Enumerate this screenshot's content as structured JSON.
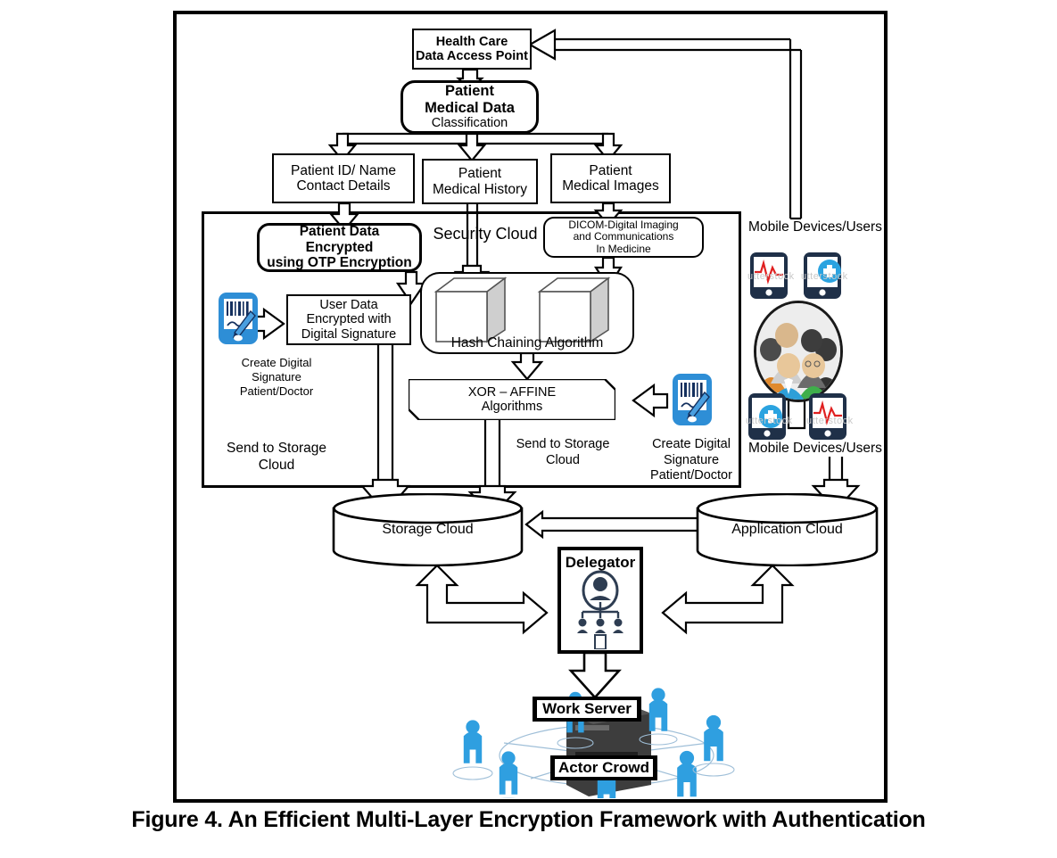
{
  "figure": {
    "caption": "Figure 4. An Efficient Multi-Layer Encryption Framework with Authentication"
  },
  "nodes": {
    "access_point": {
      "line1": "Health Care",
      "line2": "Data Access Point"
    },
    "classification": {
      "line1": "Patient",
      "line2": "Medical Data",
      "line3": "Classification"
    },
    "patient_id": {
      "line1": "Patient ID/ Name",
      "line2": "Contact Details"
    },
    "medical_history": {
      "line1": "Patient",
      "line2": "Medical History"
    },
    "medical_images": {
      "line1": "Patient",
      "line2": "Medical Images"
    },
    "security_cloud_label": "Security Cloud",
    "otp_encryption": {
      "line1": "Patient   Data",
      "line2": "Encrypted",
      "line3": "using OTP Encryption"
    },
    "dicom": {
      "line1": "DICOM-Digital Imaging",
      "line2": "and Communications",
      "line3": "In Medicine"
    },
    "user_data_sig": {
      "line1": "User Data",
      "line2": "Encrypted with",
      "line3": "Digital Signature"
    },
    "hash_chaining": {
      "label": "Hash Chaining Algorithm"
    },
    "xor_affine": {
      "line1": "XOR – AFFINE",
      "line2": "Algorithms"
    },
    "storage_cloud": {
      "label": "Storage Cloud"
    },
    "application_cloud": {
      "label": "Application Cloud"
    },
    "delegator": {
      "label": "Delegator"
    },
    "work_server": {
      "label": "Work Server"
    },
    "actor_crowd": {
      "label": "Actor Crowd"
    }
  },
  "annotations": {
    "create_sig_left": {
      "line1": "Create Digital",
      "line2": "Signature",
      "line3": "Patient/Doctor"
    },
    "send_storage_left": {
      "line1": "Send to Storage",
      "line2": "Cloud"
    },
    "send_storage_mid": {
      "line1": "Send to Storage",
      "line2": "Cloud"
    },
    "create_sig_right": {
      "line1": "Create Digital",
      "line2": "Signature",
      "line3": "Patient/Doctor"
    },
    "mobile_top": "Mobile Devices/Users",
    "mobile_bottom": "Mobile Devices/Users",
    "watermark": "utterstock"
  },
  "colors": {
    "outline": "#000000",
    "phone_dark": "#1f3048",
    "phone_blue": "#2e8ed6",
    "ecg_red": "#e02020",
    "cross_blue": "#2ba3e0",
    "person_blue": "#2f9fe0",
    "cube_face": "#ffffff",
    "cube_shade": "#c8c8c8",
    "server_dark": "#3a3a3a",
    "delegator_navy": "#2e3d52"
  }
}
